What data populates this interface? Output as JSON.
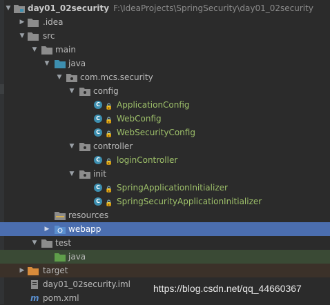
{
  "tree": {
    "root": {
      "name": "day01_02security",
      "path": "F:\\IdeaProjects\\SpringSecurity\\day01_02security"
    },
    "idea": ".idea",
    "src": "src",
    "main": "main",
    "java": "java",
    "package": "com.mcs.security",
    "config": "config",
    "application_config": "ApplicationConfig",
    "web_config": "WebConfig",
    "web_security_config": "WebSecurityConfig",
    "controller": "controller",
    "login_controller": "loginController",
    "init": "init",
    "spring_app_init": "SpringApplicationInitializer",
    "spring_sec_init": "SpringSecurityApplicationInitializer",
    "resources": "resources",
    "webapp": "webapp",
    "test": "test",
    "test_java": "java",
    "target": "target",
    "iml": "day01_02security.iml",
    "pom": "pom.xml"
  },
  "watermark": "https://blog.csdn.net/qq_44660367",
  "colors": {
    "background": "#2b2b2b",
    "selection": "#4b6eaf",
    "folder_blue": "#3d8fb0",
    "folder_gray": "#8c8c8c",
    "folder_orange": "#d88b3b",
    "class_icon": "#3d8fb0",
    "green_text": "#9ec06a"
  }
}
